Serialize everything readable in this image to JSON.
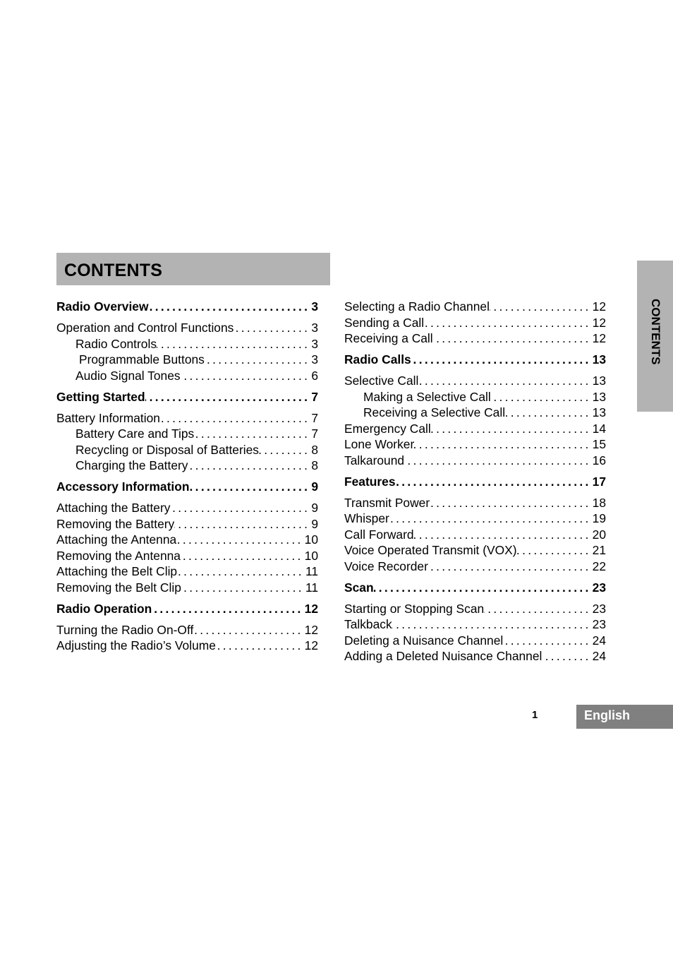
{
  "header": {
    "title": "CONTENTS"
  },
  "side_tab": {
    "label": "CONTENTS"
  },
  "footer": {
    "page_number": "1",
    "language_tab": "English"
  },
  "colors": {
    "header_bar": "#b3b3b3",
    "side_tab": "#b3b3b3",
    "language_tab": "#808080"
  },
  "toc": {
    "left": [
      {
        "text": "Radio Overview",
        "page": "3",
        "level": "section"
      },
      {
        "text": "Operation and Control Functions",
        "page": "3",
        "level": 1
      },
      {
        "text": "Radio Controls",
        "page": "3",
        "level": 2
      },
      {
        "text": "Programmable Buttons",
        "page": "3",
        "level": 2
      },
      {
        "text": "Audio Signal Tones",
        "page": "6",
        "level": 2
      },
      {
        "text": "Getting Started",
        "page": "7",
        "level": "section"
      },
      {
        "text": "Battery Information",
        "page": "7",
        "level": 1
      },
      {
        "text": "Battery Care and Tips",
        "page": "7",
        "level": 2
      },
      {
        "text": "Recycling or Disposal of Batteries",
        "page": "8",
        "level": 2
      },
      {
        "text": "Charging the Battery",
        "page": "8",
        "level": 2
      },
      {
        "text": "Accessory Information",
        "page": "9",
        "level": "section"
      },
      {
        "text": "Attaching the Battery",
        "page": "9",
        "level": 1
      },
      {
        "text": "Removing the Battery",
        "page": "9",
        "level": 1
      },
      {
        "text": "Attaching the Antenna",
        "page": "10",
        "level": 1
      },
      {
        "text": "Removing the Antenna",
        "page": "10",
        "level": 1
      },
      {
        "text": "Attaching the Belt Clip",
        "page": "11",
        "level": 1
      },
      {
        "text": "Removing the Belt Clip",
        "page": "11",
        "level": 1
      },
      {
        "text": "Radio Operation",
        "page": "12",
        "level": "section"
      },
      {
        "text": "Turning the Radio On-Off",
        "page": "12",
        "level": 1
      },
      {
        "text": "Adjusting the Radio’s Volume",
        "page": "12",
        "level": 1
      }
    ],
    "right": [
      {
        "text": "Selecting a Radio Channel",
        "page": "12",
        "level": 1
      },
      {
        "text": "Sending a Call",
        "page": "12",
        "level": 1
      },
      {
        "text": "Receiving a Call",
        "page": "12",
        "level": 1
      },
      {
        "text": "Radio Calls",
        "page": "13",
        "level": "section"
      },
      {
        "text": "Selective Call",
        "page": "13",
        "level": 1
      },
      {
        "text": "Making a Selective Call",
        "page": "13",
        "level": 2
      },
      {
        "text": "Receiving a Selective Call",
        "page": "13",
        "level": 2
      },
      {
        "text": "Emergency Call",
        "page": "14",
        "level": 1
      },
      {
        "text": "Lone Worker",
        "page": "15",
        "level": 1
      },
      {
        "text": "Talkaround",
        "page": "16",
        "level": 1
      },
      {
        "text": "Features",
        "page": "17",
        "level": "section"
      },
      {
        "text": "Transmit Power",
        "page": "18",
        "level": 1
      },
      {
        "text": "Whisper",
        "page": "19",
        "level": 1
      },
      {
        "text": "Call Forward",
        "page": "20",
        "level": 1
      },
      {
        "text": "Voice Operated Transmit (VOX)",
        "page": "21",
        "level": 1
      },
      {
        "text": "Voice Recorder",
        "page": "22",
        "level": 1
      },
      {
        "text": "Scan",
        "page": "23",
        "level": "section"
      },
      {
        "text": "Starting or Stopping Scan",
        "page": "23",
        "level": 1
      },
      {
        "text": "Talkback",
        "page": "23",
        "level": 1
      },
      {
        "text": "Deleting a Nuisance Channel",
        "page": "24",
        "level": 1
      },
      {
        "text": "Adding a Deleted Nuisance Channel",
        "page": "24",
        "level": 1
      }
    ]
  }
}
